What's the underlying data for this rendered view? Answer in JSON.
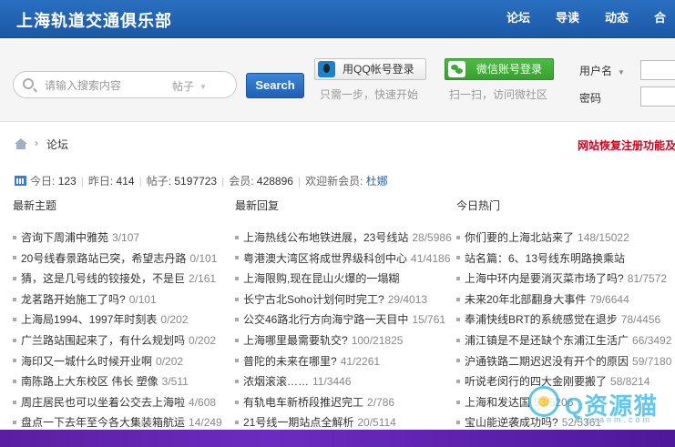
{
  "header": {
    "logo": "上海轨道交通俱乐部",
    "nav": [
      "论坛",
      "导读",
      "动态",
      "合"
    ]
  },
  "search": {
    "placeholder": "请输入搜索内容",
    "type_label": "帖子",
    "button": "Search"
  },
  "social_login": {
    "qq_button": "用QQ帐号登录",
    "qq_tip": "只需一步，快速开始",
    "wechat_button": "微信账号登录",
    "wechat_tip": "扫一扫，访问微社区"
  },
  "login": {
    "username_label": "用户名",
    "password_label": "密码"
  },
  "breadcrumb": {
    "separator": "›",
    "current": "论坛"
  },
  "notice": "网站恢复注册功能及",
  "stats": {
    "today_label": "今日:",
    "today": "123",
    "yesterday_label": "昨日:",
    "yesterday": "414",
    "posts_label": "帖子:",
    "posts": "5197723",
    "members_label": "会员:",
    "members": "428896",
    "welcome_label": "欢迎新会员:",
    "new_member": "杜娜"
  },
  "columns": [
    {
      "title": "最新主题",
      "items": [
        {
          "title": "咨询下周浦中雅苑",
          "count": "3/107"
        },
        {
          "title": "20号线春景路站已突，希望志丹路",
          "count": "0/101"
        },
        {
          "title": "猜，这是几号线的铰接处，不是巨",
          "count": "2/161"
        },
        {
          "title": "龙茗路开始施工了吗?",
          "count": "0/101"
        },
        {
          "title": "上海局1994、1997年时刻表",
          "count": "0/202"
        },
        {
          "title": "广兰路站围起来了，有什么规划吗",
          "count": "0/202"
        },
        {
          "title": "海印又一城什么时候开业啊",
          "count": "0/202"
        },
        {
          "title": "南陈路上大东校区 伟长 塑像",
          "count": "3/511"
        },
        {
          "title": "周庄居民也可以坐着公交去上海啦",
          "count": "4/608"
        },
        {
          "title": "盘点一下去年至今各大集装箱航运",
          "count": "14/249"
        }
      ]
    },
    {
      "title": "最新回复",
      "items": [
        {
          "title": "上海热线公布地铁进展，23号线站",
          "count": "28/5986"
        },
        {
          "title": "粤港澳大湾区将成世界级科创中心",
          "count": "41/4186"
        },
        {
          "title": "上海限购,现在昆山火爆的一塌糊",
          "count": ""
        },
        {
          "title": "长宁古北Soho计划何时完工?",
          "count": "29/4013"
        },
        {
          "title": "公交46路北行方向海宁路一天目中",
          "count": "15/761"
        },
        {
          "title": "上海哪里最需要轨交?",
          "count": "100/21825"
        },
        {
          "title": "普陀的未来在哪里?",
          "count": "41/2261"
        },
        {
          "title": "浓烟滚滚……",
          "count": "11/3446"
        },
        {
          "title": "有轨电车新桥段推迟完工",
          "count": "2/786"
        },
        {
          "title": "21号线一期站点全解析",
          "count": "20/5114"
        }
      ]
    },
    {
      "title": "今日热门",
      "items": [
        {
          "title": "你们要的上海北站来了",
          "count": "148/15022"
        },
        {
          "title": "站名篇：6、13号线东明路换乘站",
          "count": ""
        },
        {
          "title": "上海中环内是要消灭菜市场了吗?",
          "count": "81/7572"
        },
        {
          "title": "未来20年北部翻身大事件",
          "count": "79/6644"
        },
        {
          "title": "奉浦快线BRT的系统感觉在退步",
          "count": "78/4456"
        },
        {
          "title": "浦江镇是不是还缺个东浦江生活广",
          "count": "66/3492"
        },
        {
          "title": "沪通铁路二期迟迟没有开个的原因",
          "count": "59/7180"
        },
        {
          "title": "听说老闵行的四大金刚要搬了",
          "count": "58/8214"
        },
        {
          "title": "上海和发达国",
          "count": "53/5206"
        },
        {
          "title": "宝山能逆袭成功吗?",
          "count": "52/5361"
        }
      ]
    }
  ],
  "watermark": {
    "text": "Q资源猫",
    "sub": "ziyuanm.com"
  }
}
